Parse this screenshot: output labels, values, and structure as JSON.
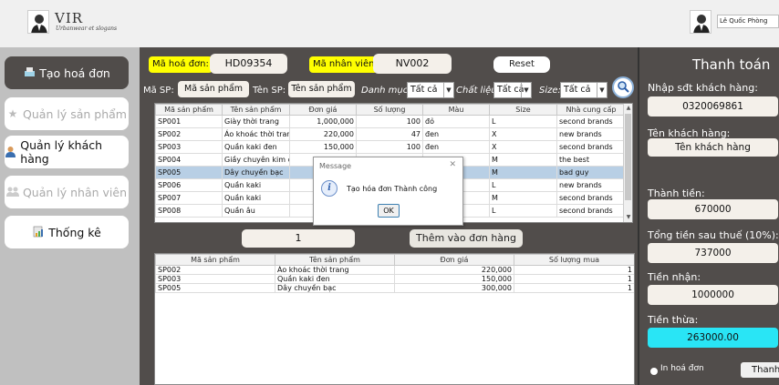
{
  "header": {
    "logo_title": "VIR",
    "logo_slogan": "Urbanwear et slogans",
    "user_name": "Lê Quốc Phòng"
  },
  "sidebar": {
    "items": [
      {
        "label": "Tạo hoá đơn",
        "icon": "cart-icon"
      },
      {
        "label": "Quản lý sản phẩm",
        "icon": "star-icon"
      },
      {
        "label": "Quản lý khách hàng",
        "icon": "customer-icon"
      },
      {
        "label": "Quản lý nhân viên",
        "icon": "staff-icon"
      },
      {
        "label": "Thống kê",
        "icon": "chart-icon"
      }
    ]
  },
  "invoice": {
    "invoice_label": "Mã hoá đơn:",
    "invoice_value": "HD09354",
    "staff_label": "Mã nhân viên",
    "staff_value": "NV002",
    "reset_label": "Reset"
  },
  "filters": {
    "code_label": "Mã SP:",
    "code_placeholder": "Mã sản phẩm",
    "name_label": "Tên SP:",
    "name_placeholder": "Tên sản phẩm",
    "category_label": "Danh mục:",
    "category_value": "Tất cả",
    "material_label": "Chất liệu:",
    "material_value": "Tất cả",
    "size_label": "Size:",
    "size_value": "Tất cả"
  },
  "products_table": {
    "headers": [
      "Mã sản phẩm",
      "Tên sản phẩm",
      "Đơn giá",
      "Số lượng",
      "Màu",
      "Size",
      "Nhà cung cấp"
    ],
    "rows": [
      [
        "SP001",
        "Giày thời trang",
        "1,000,000",
        "100",
        "đỏ",
        "L",
        "second brands"
      ],
      [
        "SP002",
        "Áo khoác thời trang",
        "220,000",
        "47",
        "đen",
        "X",
        "new brands"
      ],
      [
        "SP003",
        "Quần kaki đen",
        "150,000",
        "100",
        "đen",
        "X",
        "second brands"
      ],
      [
        "SP004",
        "Giầy chuyên kim cư...",
        "",
        "",
        "",
        "M",
        "the best"
      ],
      [
        "SP005",
        "Dây chuyền bạc",
        "",
        "",
        "",
        "M",
        "bad guy"
      ],
      [
        "SP006",
        "Quần kaki",
        "",
        "",
        "",
        "L",
        "new brands"
      ],
      [
        "SP007",
        "Quần kaki",
        "",
        "",
        "",
        "M",
        "second brands"
      ],
      [
        "SP008",
        "Quần âu",
        "",
        "",
        "",
        "L",
        "second brands"
      ]
    ],
    "selected_row": 4
  },
  "quantity_value": "1",
  "add_button_label": "Thêm vào đơn hàng",
  "cart_table": {
    "headers": [
      "Mã sản phẩm",
      "Tên sản phẩm",
      "Đơn giá",
      "Số lượng mua"
    ],
    "rows": [
      [
        "SP002",
        "Áo khoác thời trang",
        "220,000",
        "1"
      ],
      [
        "SP003",
        "Quần kaki đen",
        "150,000",
        "1"
      ],
      [
        "SP005",
        "Dây chuyền bạc",
        "300,000",
        "1"
      ]
    ]
  },
  "dialog": {
    "title": "Message",
    "message": "Tạo hóa đơn Thành công",
    "ok_label": "OK",
    "close_glyph": "✕",
    "info_glyph": "i"
  },
  "payment": {
    "title": "Thanh toán",
    "phone_label": "Nhập sđt khách hàng:",
    "phone_value": "0320069861",
    "customer_label": "Tên khách hàng:",
    "customer_value": "Tên khách hàng",
    "amount_label": "Thành tiền:",
    "amount_value": "670000",
    "total_tax_label": "Tổng tiền sau thuế (10%):",
    "total_tax_value": "737000",
    "received_label": "Tiền nhận:",
    "received_value": "1000000",
    "change_label": "Tiền thừa:",
    "change_value": "263000.00",
    "print_label": "In hoá đơn",
    "pay_button_label": "Thanh toán"
  },
  "colors": {
    "panel_bg": "#514d4b",
    "sidebar_bg": "#c0c0c0",
    "highlight_yellow": "#ffff00",
    "change_cyan": "#29e5f5",
    "selected_row": "#b8cfe5"
  }
}
